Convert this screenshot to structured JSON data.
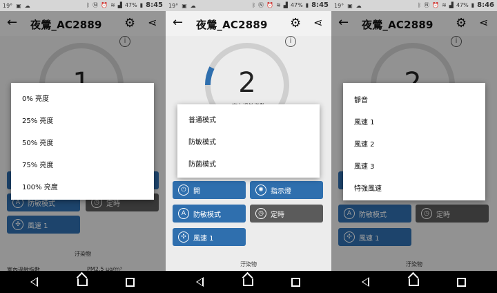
{
  "status": {
    "temp": "19°",
    "battery_pct": "47%",
    "times": [
      "8:45",
      "8:45",
      "8:46"
    ]
  },
  "app": {
    "title": "夜鶯_AC2889"
  },
  "screens": [
    {
      "gauge_value": "1",
      "gauge_label": "",
      "tiles": [
        "",
        "防敏模式",
        "定時",
        "風速 1"
      ],
      "pollutants": "汙染物",
      "pm_label": "室內過敏指數",
      "pm_value": "PM2.5 µg/m³",
      "dialog": [
        "0% 亮度",
        "25% 亮度",
        "50% 亮度",
        "75% 亮度",
        "100% 亮度"
      ]
    },
    {
      "gauge_value": "2",
      "gauge_label": "室內過敏指數",
      "tiles": [
        "開",
        "指示燈",
        "防敏模式",
        "定時",
        "風速 1"
      ],
      "pollutants": "汙染物",
      "dialog": [
        "普通模式",
        "防敏模式",
        "防菌模式"
      ]
    },
    {
      "gauge_value": "2",
      "gauge_label": "",
      "tiles": [
        "防敏模式",
        "定時",
        "風速 1"
      ],
      "pollutants": "汙染物",
      "dialog": [
        "靜音",
        "風速 1",
        "風速 2",
        "風速 3",
        "特強風速"
      ]
    }
  ],
  "icons": {
    "back": "arrow-left-icon",
    "settings": "gear-icon",
    "share": "share-icon",
    "info": "info-icon"
  },
  "colors": {
    "tile_blue": "#2f6fae",
    "tile_gray": "#5b5b5b",
    "gauge_blue": "#2f6fae"
  }
}
